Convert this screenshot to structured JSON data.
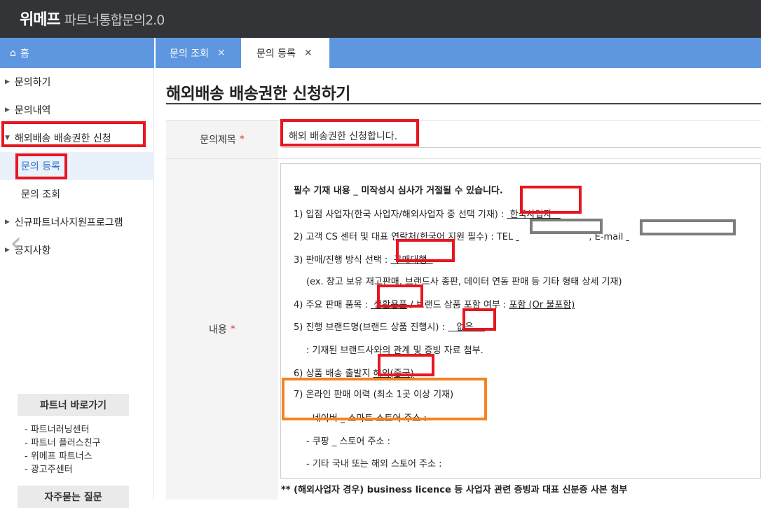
{
  "header": {
    "brand_strong": "위메프",
    "brand_sub": "파트너통합문의2.0"
  },
  "tabs": {
    "home_label": "홈",
    "items": [
      {
        "label": "문의 조회",
        "close": "✕"
      },
      {
        "label": "문의 등록",
        "close": "✕"
      }
    ]
  },
  "sidebar": {
    "items": [
      {
        "label": "문의하기"
      },
      {
        "label": "문의내역"
      },
      {
        "label": "해외배송 배송권한 신청"
      }
    ],
    "subitems": [
      {
        "label": "문의 등록"
      },
      {
        "label": "문의 조회"
      }
    ],
    "items_after": [
      {
        "label": "신규파트너사지원프로그램"
      },
      {
        "label": "공지사항"
      }
    ],
    "partner_box": {
      "title": "파트너 바로가기",
      "links": [
        "- 파트너러닝센터",
        "- 파트너 플러스친구",
        "- 위메프 파트너스",
        "- 광고주센터"
      ],
      "faq_title": "자주묻는 질문"
    }
  },
  "main": {
    "title": "해외배송 배송권한 신청하기",
    "subject_label": "문의제목",
    "required_mark": "*",
    "subject_value": "해외 배송권한 신청합니다.",
    "body_label": "내용",
    "editor": {
      "heading": "필수 기재 내용 _ 미작성시 심사가 거절될 수 있습니다.",
      "l1_prefix": "1) 입점 사업자(한국 사업자/해외사업자 중 선택 기재) :",
      "l1_value": "한국사업자",
      "l2_prefix": "2) 고객 CS 센터 및 대표 연락처(한국어 지원 필수) : TEL",
      "l2_email": ", E-mail",
      "l3_prefix": "3) 판매/진행 방식 선택 :",
      "l3_value": "구매대행",
      "l3_note": "(ex. 창고 보유 재고판매, 브랜드사 종판, 데이터 연동 판매 등 기타 형태 상세 기재)",
      "l4_prefix": "4) 주요 판매 품목 :",
      "l4_value": "생활용품",
      "l4_mid": "/ 브랜드 상품 포함 여부 :",
      "l4_choice": "포함 (Or 불포함)",
      "l5_prefix": "5) 진행 브랜드명(브랜드 상품 진행시) :",
      "l5_value": "없음",
      "l5_note": ": 기재된 브랜드사와의 관계 및 증빙 자료 첨부.",
      "l6_prefix": "6) 상품 배송 출발지",
      "l6_value": "해외(중국)",
      "l7": "7) 온라인 판매 이력 (최소 1곳 이상 기재)",
      "l7a": "- 네이버 _ 스마트 스토어 주소 :",
      "l7b": "- 쿠팡 _ 스토어 주소 :",
      "l7c": "- 기타 국내 또는 해외 스토어 주소 :"
    },
    "footnote": "** (해외사업자 경우) business licence 등 사업자 관련 증빙과 대표 신분증 사본 첨부"
  },
  "colors": {
    "header_bg": "#333438",
    "tab_blue": "#5e97df",
    "highlight_red": "#e8161f",
    "highlight_orange": "#f28521"
  }
}
